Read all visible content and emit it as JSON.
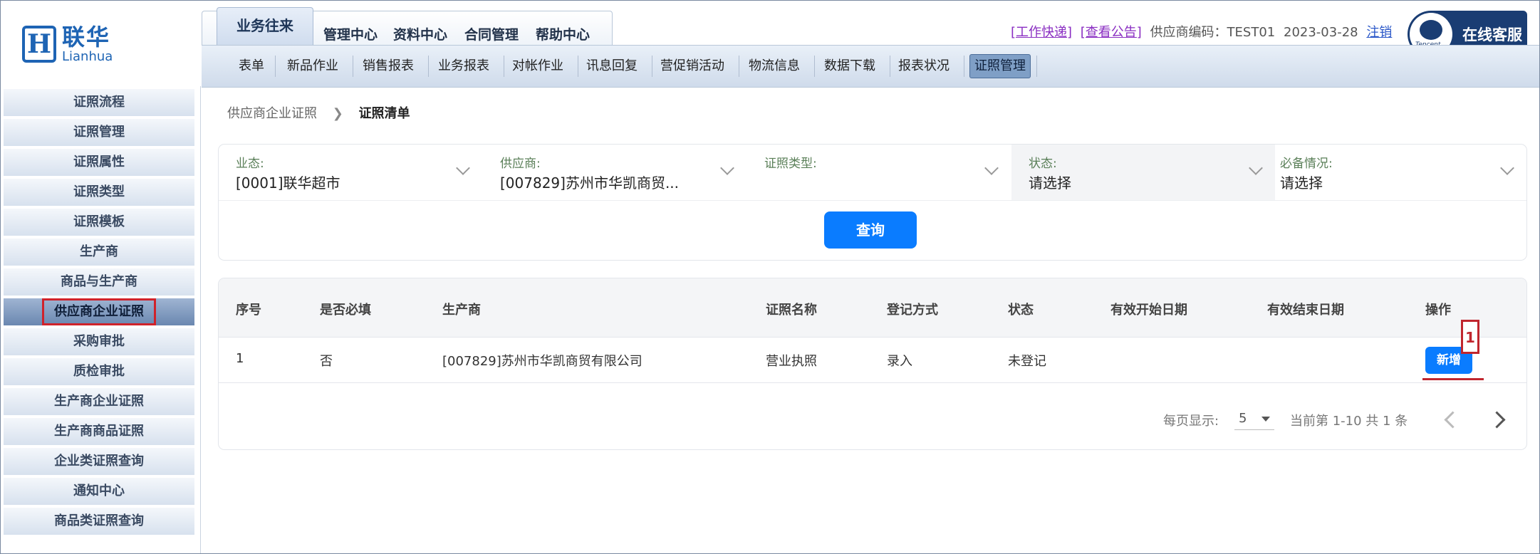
{
  "logo": {
    "mark": "H",
    "cn": "联华",
    "en": "Lianhua"
  },
  "main_tabs": [
    "业务往来",
    "管理中心",
    "资料中心",
    "合同管理",
    "帮助中心"
  ],
  "header": {
    "work_link": "[工作快递]",
    "notice_link": "[查看公告]",
    "supplier_code": "供应商编码：TEST01",
    "date": "2023-03-28",
    "logout": "注销"
  },
  "customer_service": {
    "label": "在线客服",
    "avatar_icon": "tencent-support-icon"
  },
  "sub_nav": [
    "表单",
    "新品作业",
    "销售报表",
    "业务报表",
    "对帐作业",
    "讯息回复",
    "营促销活动",
    "物流信息",
    "数据下载",
    "报表状况",
    "证照管理"
  ],
  "sidebar": [
    "证照流程",
    "证照管理",
    "证照属性",
    "证照类型",
    "证照模板",
    "生产商",
    "商品与生产商",
    "供应商企业证照",
    "采购审批",
    "质检审批",
    "生产商企业证照",
    "生产商商品证照",
    "企业类证照查询",
    "通知中心",
    "商品类证照查询"
  ],
  "breadcrumb": {
    "parent": "供应商企业证照",
    "current": "证照清单"
  },
  "filters": [
    {
      "label": "业态:",
      "value": "[0001]联华超市"
    },
    {
      "label": "供应商:",
      "value": "[007829]苏州市华凯商贸..."
    },
    {
      "label": "证照类型:",
      "value": ""
    },
    {
      "label": "状态:",
      "value": "请选择"
    },
    {
      "label": "必备情况:",
      "value": "请选择"
    }
  ],
  "query_label": "查询",
  "table": {
    "headers": [
      "序号",
      "是否必填",
      "生产商",
      "证照名称",
      "登记方式",
      "状态",
      "有效开始日期",
      "有效结束日期",
      "操作"
    ],
    "rows": [
      {
        "no": "1",
        "required": "否",
        "manufacturer": "[007829]苏州市华凯商贸有限公司",
        "license": "营业执照",
        "method": "录入",
        "status": "未登记",
        "start": "",
        "end": "",
        "action": "新增"
      }
    ]
  },
  "marker": "1",
  "pagination": {
    "per_page_label": "每页显示:",
    "per_page": "5",
    "info": "当前第 1-10 共 1 条"
  }
}
